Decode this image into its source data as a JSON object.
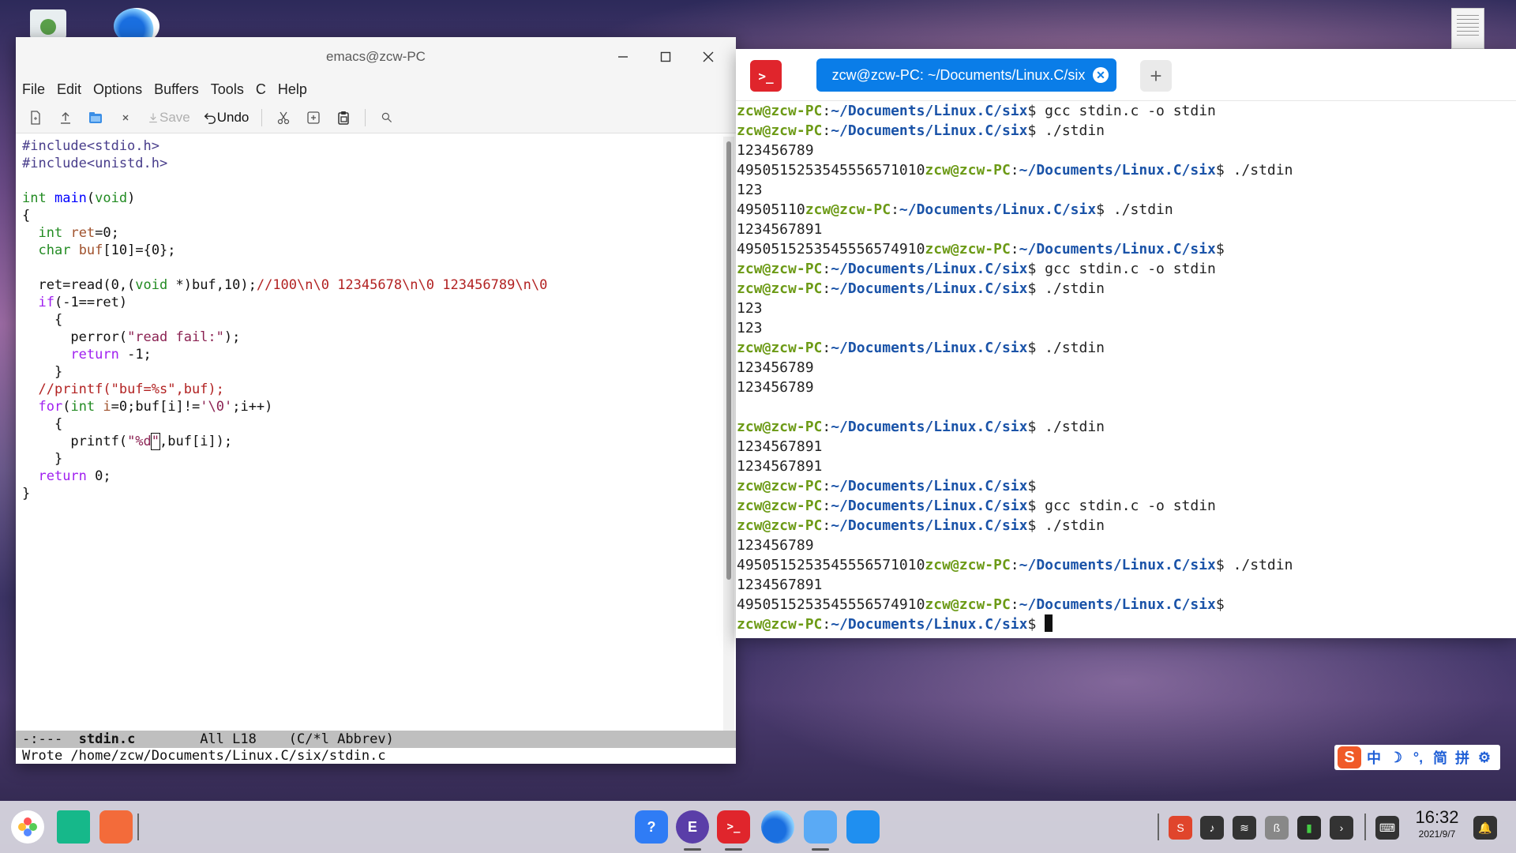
{
  "emacs": {
    "title": "emacs@zcw-PC",
    "menu": [
      "File",
      "Edit",
      "Options",
      "Buffers",
      "Tools",
      "C",
      "Help"
    ],
    "toolbar": {
      "save_label": "Save",
      "undo_label": "Undo"
    },
    "code": {
      "l1": "#include<stdio.h>",
      "l2": "#include<unistd.h>",
      "l4a": "int",
      "l4b": "main",
      "l4c": "(",
      "l4d": "void",
      "l4e": ")",
      "l5": "{",
      "l6a": "  ",
      "l6b": "int",
      "l6c": " ",
      "l6d": "ret",
      "l6e": "=0;",
      "l7b": "char",
      "l7d": "buf",
      "l7e": "[10]={0};",
      "l9a": "  ret=read(0,(",
      "l9b": "void",
      "l9c": " *)buf,10);",
      "l9d": "//100\\n\\0 12345678\\n\\0 123456789\\n\\0",
      "l10a": "if",
      "l10b": "(-1==ret)",
      "l11": "    {",
      "l12a": "      perror(",
      "l12b": "\"read fail:\"",
      "l12c": ");",
      "l13a": "return",
      "l13b": " -1;",
      "l14": "    }",
      "l15": "//printf(\"buf=%s\",buf);",
      "l16a": "for",
      "l16b": "(",
      "l16c": "int",
      "l16d": " ",
      "l16e": "i",
      "l16f": "=0;buf[i]!=",
      "l16g": "'\\0'",
      "l16h": ";i++)",
      "l17": "    {",
      "l18a": "      printf(",
      "l18b": "\"%d",
      "l18c": "\"",
      "l18d": ",buf[i]);",
      "l19": "    }",
      "l20a": "return",
      "l20b": " 0;",
      "l21": "}"
    },
    "modeline": {
      "prefix": "-:---  ",
      "buffer": "stdin.c",
      "rest": "        All L18    (C/*l Abbrev)"
    },
    "echo": "Wrote /home/zcw/Documents/Linux.C/six/stdin.c"
  },
  "terminal": {
    "tab_title": "zcw@zcw-PC: ~/Documents/Linux.C/six",
    "user": "zcw@zcw-PC",
    "colon": ":",
    "path": "~/Documents/Linux.C/six",
    "dollar": "$ ",
    "lines": [
      {
        "pre": "",
        "prompt": true,
        "cmd": "gcc stdin.c -o stdin"
      },
      {
        "pre": "",
        "prompt": true,
        "cmd": "./stdin"
      },
      {
        "pre": "123456789",
        "prompt": false,
        "cmd": ""
      },
      {
        "pre": "4950515253545556571010",
        "prompt": true,
        "cmd": "./stdin"
      },
      {
        "pre": "123",
        "prompt": false,
        "cmd": ""
      },
      {
        "pre": "49505110",
        "prompt": true,
        "cmd": "./stdin"
      },
      {
        "pre": "1234567891",
        "prompt": false,
        "cmd": ""
      },
      {
        "pre": "4950515253545556574910",
        "prompt": true,
        "cmd": ""
      },
      {
        "pre": "",
        "prompt": true,
        "cmd": "gcc stdin.c -o stdin"
      },
      {
        "pre": "",
        "prompt": true,
        "cmd": "./stdin"
      },
      {
        "pre": "123",
        "prompt": false,
        "cmd": ""
      },
      {
        "pre": "123",
        "prompt": false,
        "cmd": ""
      },
      {
        "pre": "",
        "prompt": true,
        "cmd": "./stdin"
      },
      {
        "pre": "123456789",
        "prompt": false,
        "cmd": ""
      },
      {
        "pre": "123456789",
        "prompt": false,
        "cmd": ""
      },
      {
        "pre": "",
        "prompt": false,
        "cmd": ""
      },
      {
        "pre": "",
        "prompt": true,
        "cmd": "./stdin"
      },
      {
        "pre": "1234567891",
        "prompt": false,
        "cmd": ""
      },
      {
        "pre": "1234567891",
        "prompt": false,
        "cmd": ""
      },
      {
        "pre": "",
        "prompt": true,
        "cmd": ""
      },
      {
        "pre": "",
        "prompt": true,
        "cmd": "gcc stdin.c -o stdin"
      },
      {
        "pre": "",
        "prompt": true,
        "cmd": "./stdin"
      },
      {
        "pre": "123456789",
        "prompt": false,
        "cmd": ""
      },
      {
        "pre": "4950515253545556571010",
        "prompt": true,
        "cmd": "./stdin"
      },
      {
        "pre": "1234567891",
        "prompt": false,
        "cmd": ""
      },
      {
        "pre": "4950515253545556574910",
        "prompt": true,
        "cmd": ""
      },
      {
        "pre": "",
        "prompt": true,
        "cmd": "",
        "cursor": true
      }
    ]
  },
  "ime": {
    "items": [
      "中",
      "☽",
      "°,",
      "简",
      "拼",
      "⚙"
    ]
  },
  "clock": {
    "time": "16:32",
    "date": "2021/9/7"
  },
  "colors": {
    "terminal_user": "#6c9a16",
    "terminal_path": "#1a53a8",
    "tab_accent": "#0a7de8",
    "terminal_logo": "#e0252c"
  }
}
